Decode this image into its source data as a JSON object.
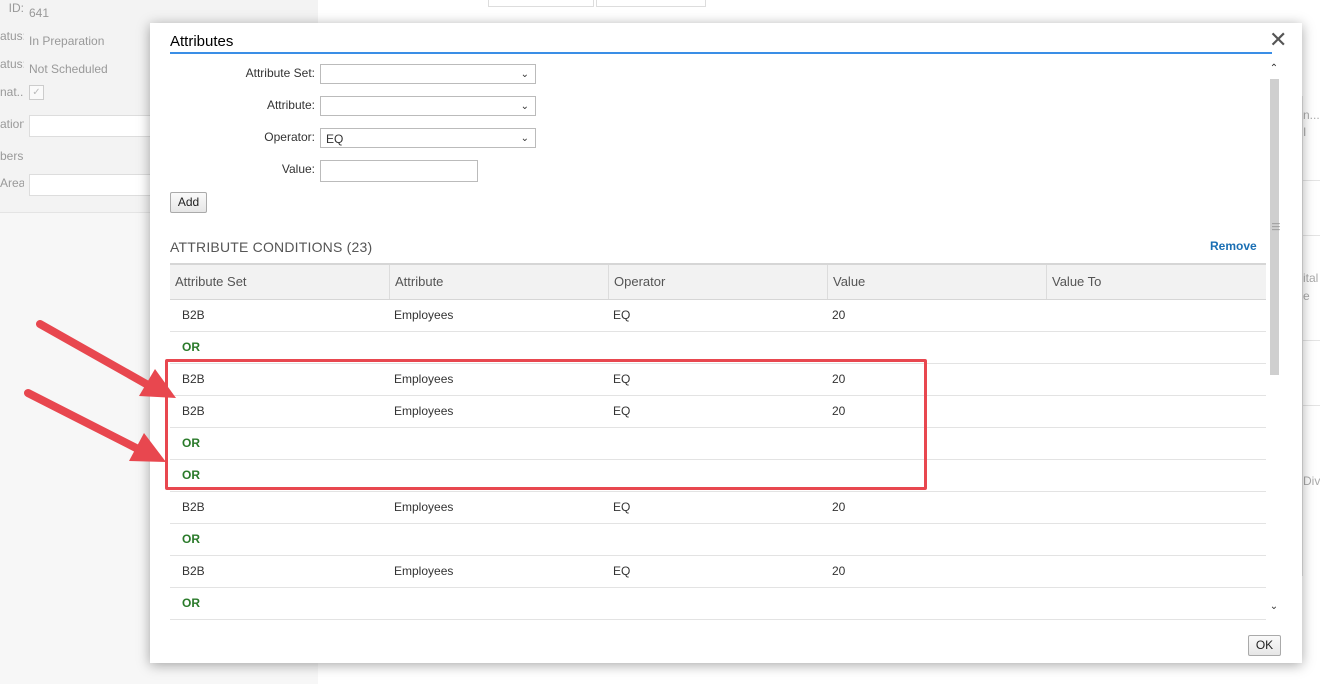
{
  "background": {
    "left_rows": [
      {
        "label": "ID:",
        "value": "641"
      },
      {
        "label": "atus:",
        "value": "In Preparation"
      },
      {
        "label": "atus:",
        "value": "Not Scheduled"
      },
      {
        "label": "nat...",
        "value": ""
      },
      {
        "label": "ation:",
        "value": ""
      },
      {
        "label": "bers:",
        "value": ""
      },
      {
        "label": "Area:",
        "value": ""
      }
    ],
    "right_texts": [
      "n...",
      "I",
      "ital",
      "e",
      "Div"
    ]
  },
  "dialog": {
    "title": "Attributes",
    "close_icon": "close-icon",
    "form": {
      "attribute_set_label": "Attribute Set:",
      "attribute_set_value": "",
      "attribute_label": "Attribute:",
      "attribute_value": "",
      "operator_label": "Operator:",
      "operator_value": "EQ",
      "value_label": "Value:",
      "value_value": ""
    },
    "add_label": "Add",
    "section_title": "ATTRIBUTE CONDITIONS (23)",
    "remove_label": "Remove",
    "columns": [
      "Attribute Set",
      "Attribute",
      "Operator",
      "Value",
      "Value To"
    ],
    "rows": [
      {
        "type": "cond",
        "attribute_set": "B2B",
        "attribute": "Employees",
        "operator": "EQ",
        "value": "20",
        "value_to": ""
      },
      {
        "type": "or",
        "label": "OR"
      },
      {
        "type": "cond",
        "attribute_set": "B2B",
        "attribute": "Employees",
        "operator": "EQ",
        "value": "20",
        "value_to": ""
      },
      {
        "type": "cond",
        "attribute_set": "B2B",
        "attribute": "Employees",
        "operator": "EQ",
        "value": "20",
        "value_to": ""
      },
      {
        "type": "or",
        "label": "OR"
      },
      {
        "type": "or",
        "label": "OR"
      },
      {
        "type": "cond",
        "attribute_set": "B2B",
        "attribute": "Employees",
        "operator": "EQ",
        "value": "20",
        "value_to": ""
      },
      {
        "type": "or",
        "label": "OR"
      },
      {
        "type": "cond",
        "attribute_set": "B2B",
        "attribute": "Employees",
        "operator": "EQ",
        "value": "20",
        "value_to": ""
      },
      {
        "type": "or",
        "label": "OR"
      }
    ],
    "ok_label": "OK"
  },
  "annotation": {
    "highlight_color": "#e8474f",
    "arrow_color": "#e8474f"
  }
}
